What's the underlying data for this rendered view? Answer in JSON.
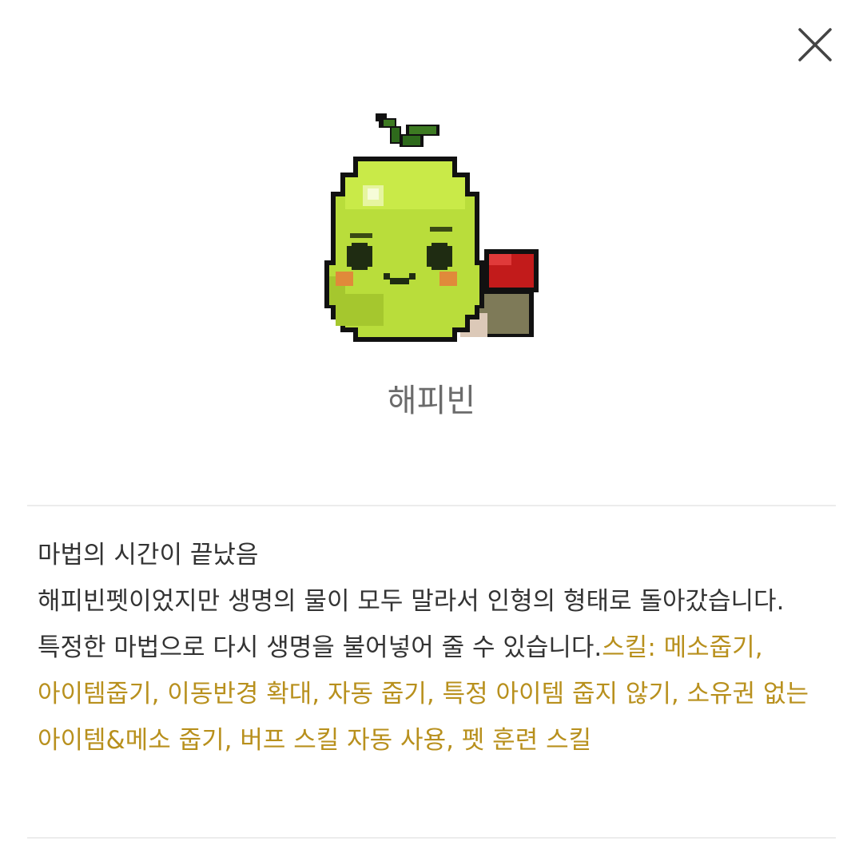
{
  "close": {
    "label": "close"
  },
  "pet": {
    "name": "해피빈"
  },
  "description": {
    "line1": "마법의 시간이 끝났음",
    "line2": "해피빈펫이었지만 생명의 물이 모두 말라서 인형의 형태로 돌아갔습니다. 특정한 마법으로 다시 생명을 불어넣어 줄 수 있습니다.",
    "skills": "스킬: 메소줍기, 아이템줍기, 이동반경 확대, 자동 줍기, 특정 아이템 줍지 않기, 소유권 없는 아이템&메소 줍기, 버프 스킬 자동 사용, 펫 훈련 스킬"
  },
  "colors": {
    "skill_text": "#b8901d",
    "body_text": "#333333",
    "name_text": "#6b6b6b",
    "divider": "#ececec"
  }
}
